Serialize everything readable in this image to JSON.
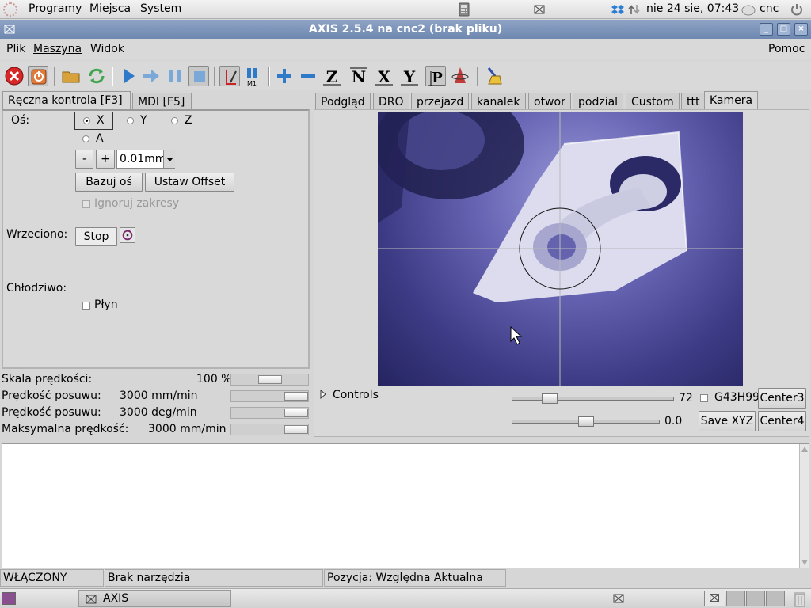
{
  "top_panel": {
    "menus": [
      "Programy",
      "Miejsca",
      "System"
    ],
    "datetime": "nie 24 sie, 07:43",
    "user": "cnc"
  },
  "window": {
    "title": "AXIS 2.5.4 na cnc2 (brak pliku)"
  },
  "menubar": {
    "items": [
      "Plik",
      "Maszyna",
      "Widok"
    ],
    "help": "Pomoc"
  },
  "left_tabs": [
    "Ręczna kontrola [F3]",
    "MDI [F5]"
  ],
  "manual": {
    "axis_label": "Oś:",
    "axes": [
      "X",
      "Y",
      "Z",
      "A"
    ],
    "minus": "-",
    "plus": "+",
    "increment": "0.01mm",
    "home_button": "Bazuj oś",
    "offset_button": "Ustaw Offset",
    "ignore_limits": "Ignoruj zakresy",
    "spindle_label": "Wrzeciono:",
    "stop_button": "Stop",
    "coolant_label": "Chłodziwo:",
    "flood_label": "Płyn"
  },
  "overrides": [
    {
      "label": "Skala prędkości:",
      "value": "100 %",
      "fraction": 0.5
    },
    {
      "label": "Prędkość posuwu:",
      "value": "3000 mm/min",
      "fraction": 1.0
    },
    {
      "label": "Prędkość posuwu:",
      "value": "3000 deg/min",
      "fraction": 1.0
    },
    {
      "label": "Maksymalna prędkość:",
      "value": "3000 mm/min",
      "fraction": 1.0
    }
  ],
  "right_tabs": [
    "Podgląd",
    "DRO",
    "przejazd",
    "kanalek",
    "otwor",
    "podzial",
    "Custom",
    "ttt",
    "Kamera"
  ],
  "camera": {
    "controls_label": "Controls",
    "scale1_value": "72",
    "scale1_fraction": 0.2,
    "scale2_value": "0.0",
    "scale2_fraction": 0.5,
    "g43h99_label": "G43H99",
    "center3": "Center3",
    "save_xyz": "Save XYZ",
    "center4": "Center4"
  },
  "status": {
    "machine": "WŁĄCZONY",
    "tool": "Brak narzędzia",
    "position": "Pozycja: Względna Aktualna"
  },
  "taskbar": {
    "app": "AXIS"
  },
  "colors": {
    "titlebar": "#7d95bb",
    "estop_red": "#d62828",
    "toolbar_blue": "#2f79c9"
  }
}
